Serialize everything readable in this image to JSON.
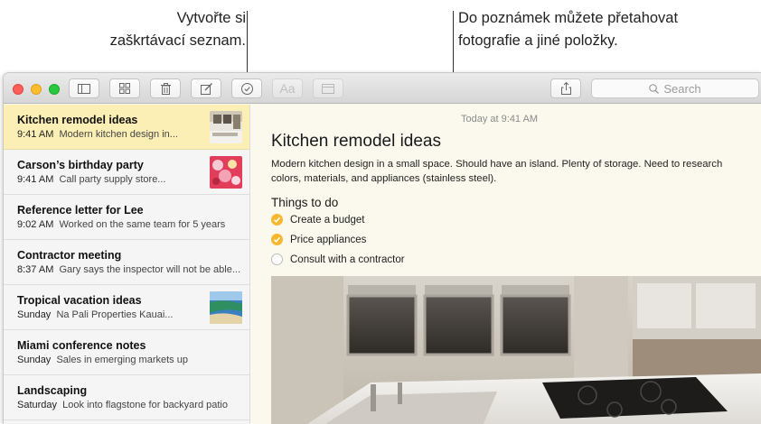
{
  "callouts": {
    "left": {
      "line1": "Vytvořte si",
      "line2": "zaškrtávací seznam."
    },
    "right": {
      "line1": "Do poznámek můžete přetahovat",
      "line2": "fotografie a jiné položky."
    }
  },
  "toolbar": {
    "buttons": [
      "sidebar-toggle",
      "attachments-browser",
      "delete",
      "new-note",
      "checklist",
      "format",
      "table"
    ],
    "format_label": "Aa",
    "search_placeholder": "Search"
  },
  "notes": [
    {
      "title": "Kitchen remodel ideas",
      "time": "9:41 AM",
      "snippet": "Modern kitchen design in...",
      "selected": true,
      "thumb": "kitchen"
    },
    {
      "title": "Carson’s birthday party",
      "time": "9:41 AM",
      "snippet": "Call party supply store...",
      "selected": false,
      "thumb": "party"
    },
    {
      "title": "Reference letter for Lee",
      "time": "9:02 AM",
      "snippet": "Worked on the same team for 5 years",
      "selected": false
    },
    {
      "title": "Contractor meeting",
      "time": "8:37 AM",
      "snippet": "Gary says the inspector will not be able...",
      "selected": false
    },
    {
      "title": "Tropical vacation ideas",
      "time": "Sunday",
      "snippet": "Na Pali Properties Kauai...",
      "selected": false,
      "thumb": "beach"
    },
    {
      "title": "Miami conference notes",
      "time": "Sunday",
      "snippet": "Sales in emerging markets up",
      "selected": false
    },
    {
      "title": "Landscaping",
      "time": "Saturday",
      "snippet": "Look into flagstone for backyard patio",
      "selected": false
    }
  ],
  "editor": {
    "date": "Today at 9:41 AM",
    "title": "Kitchen remodel ideas",
    "body": "Modern kitchen design in a small space. Should have an island. Plenty of storage. Need to research colors, materials, and appliances (stainless steel).",
    "checklist_heading": "Things to do",
    "checklist": [
      {
        "text": "Create a budget",
        "done": true
      },
      {
        "text": "Price appliances",
        "done": true
      },
      {
        "text": "Consult with a contractor",
        "done": false
      }
    ]
  },
  "colors": {
    "selected_note": "#fbefb5",
    "check_done": "#f5b82e",
    "editor_bg": "#fbf8ee"
  }
}
